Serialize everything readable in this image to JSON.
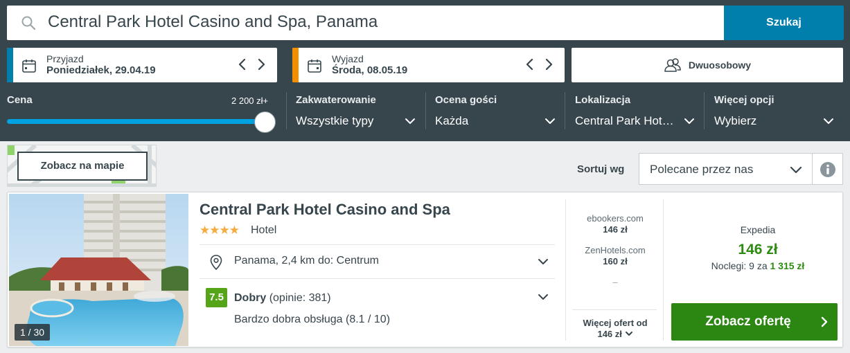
{
  "search": {
    "query": "Central Park Hotel Casino and Spa, Panama",
    "button_label": "Szukaj"
  },
  "checkin": {
    "label": "Przyjazd",
    "value": "Poniedziałek, 29.04.19",
    "color": "#007fad"
  },
  "checkout": {
    "label": "Wyjazd",
    "value": "Środa, 08.05.19",
    "color": "#f48f00"
  },
  "room": {
    "label": "Dwuosobowy"
  },
  "filters": {
    "price": {
      "label": "Cena",
      "max_label": "2 200 zł+",
      "level": 1.0
    },
    "accommodation": {
      "label": "Zakwaterowanie",
      "value": "Wszystkie typy"
    },
    "rating": {
      "label": "Ocena gości",
      "value": "Każda"
    },
    "location": {
      "label": "Lokalizacja",
      "value": "Central Park Hot…"
    },
    "more": {
      "label": "Więcej opcji",
      "value": "Wybierz"
    }
  },
  "map": {
    "button_label": "Zobacz na mapie"
  },
  "sort": {
    "label": "Sortuj wg",
    "value": "Polecane przez nas"
  },
  "hotel": {
    "name": "Central Park Hotel Casino and Spa",
    "stars": "★★★★",
    "type": "Hotel",
    "location": "Panama, 2,4 km do: Centrum",
    "score": "7.5",
    "score_word": "Dobry",
    "reviews": "(opinie: 381)",
    "service": "Bardzo dobra obsługa (8.1 / 10)",
    "photo_counter": "1 / 30"
  },
  "providers": [
    {
      "name": "ebookers.com",
      "price": "146 zł"
    },
    {
      "name": "ZenHotels.com",
      "price": "160 zł"
    }
  ],
  "provider_placeholder": "–",
  "more_offers": {
    "label": "Więcej ofert od",
    "price": "146 zł"
  },
  "best_offer": {
    "provider": "Expedia",
    "price": "146 zł",
    "nights_label": "Noclegi: 9 za",
    "total": "1 315 zł",
    "cta_label": "Zobacz ofertę"
  }
}
